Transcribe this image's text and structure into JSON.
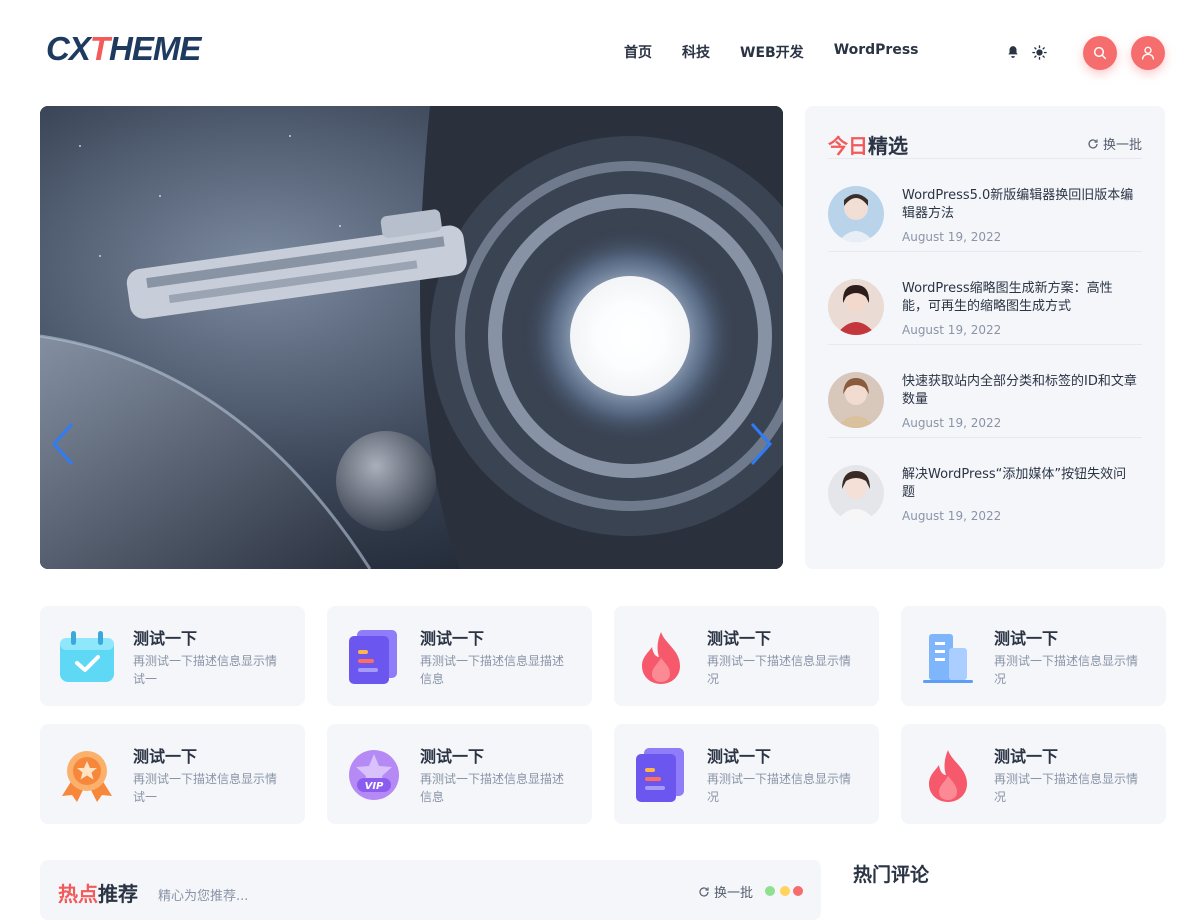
{
  "header": {
    "logo": {
      "part1": "CX",
      "part2": "T",
      "part3": "HEME"
    },
    "nav": [
      "首页",
      "科技",
      "WEB开发",
      "WordPress"
    ],
    "icons": [
      "bell-icon",
      "sun-icon",
      "search-icon",
      "user-icon"
    ],
    "accent": "#f66d6d"
  },
  "picks": {
    "title_red": "今日",
    "title_dark": "精选",
    "refresh": "换一批",
    "items": [
      {
        "title": "WordPress5.0新版编辑器换回旧版本编辑器方法",
        "date": "August 19, 2022"
      },
      {
        "title": "WordPress缩略图生成新方案：高性能，可再生的缩略图生成方式",
        "date": "August 19, 2022"
      },
      {
        "title": "快速获取站内全部分类和标签的ID和文章数量",
        "date": "August 19, 2022"
      },
      {
        "title": "解决WordPress“添加媒体”按钮失效问题",
        "date": "August 19, 2022"
      }
    ]
  },
  "cards": [
    {
      "title": "测试一下",
      "desc": "再测试一下描述信息显示情试一",
      "icon": "calendar-icon"
    },
    {
      "title": "测试一下",
      "desc": "再测试一下描述信息显描述信息",
      "icon": "document-icon"
    },
    {
      "title": "测试一下",
      "desc": "再测试一下描述信息显示情况",
      "icon": "fire-icon"
    },
    {
      "title": "测试一下",
      "desc": "再测试一下描述信息显示情况",
      "icon": "building-icon"
    },
    {
      "title": "测试一下",
      "desc": "再测试一下描述信息显示情试一",
      "icon": "medal-icon"
    },
    {
      "title": "测试一下",
      "desc": "再测试一下描述信息显描述信息",
      "icon": "vip-icon"
    },
    {
      "title": "测试一下",
      "desc": "再测试一下描述信息显示情况",
      "icon": "document-icon"
    },
    {
      "title": "测试一下",
      "desc": "再测试一下描述信息显示情况",
      "icon": "fire-icon"
    }
  ],
  "vip_label": "VIP",
  "hot": {
    "title_red": "热点",
    "title_dark": "推荐",
    "subtitle": "精心为您推荐...",
    "refresh": "换一批",
    "dot_colors": [
      "#8fe08f",
      "#ffd35c",
      "#f66d6d"
    ]
  },
  "comments": {
    "title": "热门评论"
  }
}
